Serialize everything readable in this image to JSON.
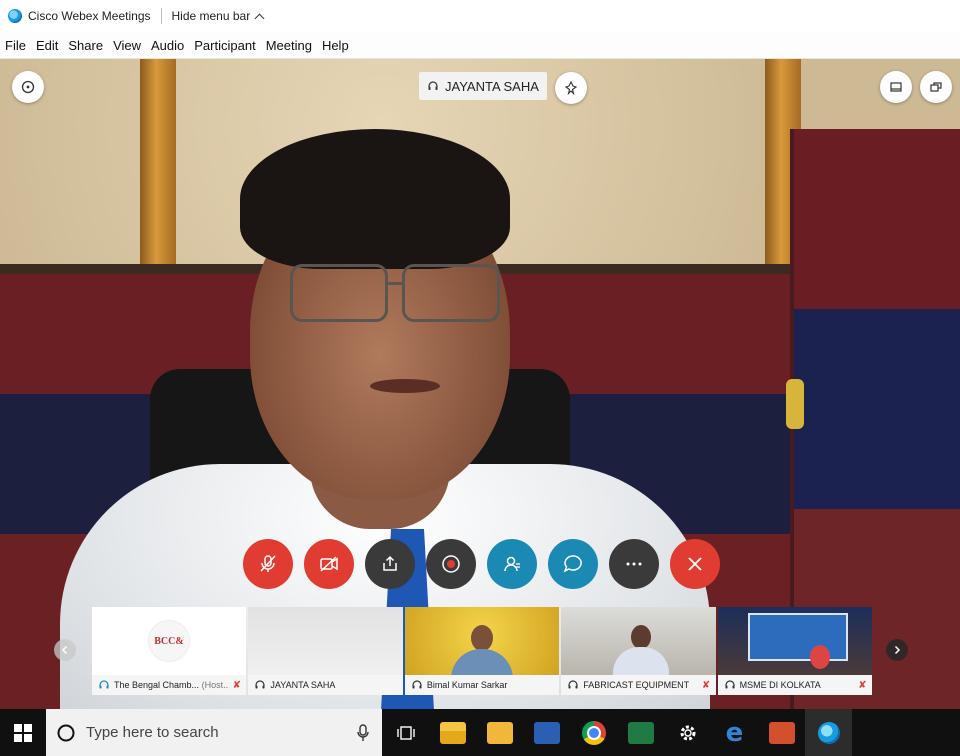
{
  "window": {
    "app_title": "Cisco Webex Meetings",
    "hide_menu_label": "Hide menu bar"
  },
  "menu": [
    "File",
    "Edit",
    "Share",
    "View",
    "Audio",
    "Participant",
    "Meeting",
    "Help"
  ],
  "active_speaker": {
    "name": "JAYANTA SAHA"
  },
  "controls": [
    {
      "name": "mute-button",
      "icon": "mic-off-icon",
      "color": "#e03c31"
    },
    {
      "name": "stop-video-button",
      "icon": "video-off-icon",
      "color": "#e03c31"
    },
    {
      "name": "share-button",
      "icon": "share-icon",
      "color": "#3a3a3a"
    },
    {
      "name": "record-button",
      "icon": "record-icon",
      "color": "#3a3a3a"
    },
    {
      "name": "participants-button",
      "icon": "participants-icon",
      "color": "#1a8ab5"
    },
    {
      "name": "chat-button",
      "icon": "chat-icon",
      "color": "#1a8ab5"
    },
    {
      "name": "more-button",
      "icon": "more-icon",
      "color": "#3a3a3a"
    },
    {
      "name": "end-meeting-button",
      "icon": "close-icon",
      "color": "#e03c31"
    }
  ],
  "thumbnails": [
    {
      "name": "The Bengal Chamb...",
      "role": "(Host...)",
      "logo_text": "BCC&"
    },
    {
      "name": "JAYANTA SAHA"
    },
    {
      "name": "Bimal Kumar Sarkar"
    },
    {
      "name": "FABRICAST EQUIPMENT"
    },
    {
      "name": "MSME DI KOLKATA"
    }
  ],
  "taskbar": {
    "search_placeholder": "Type here to search"
  },
  "colors": {
    "accent_red": "#e03c31",
    "accent_blue": "#1a8ab5",
    "dark_button": "#3a3a3a"
  }
}
